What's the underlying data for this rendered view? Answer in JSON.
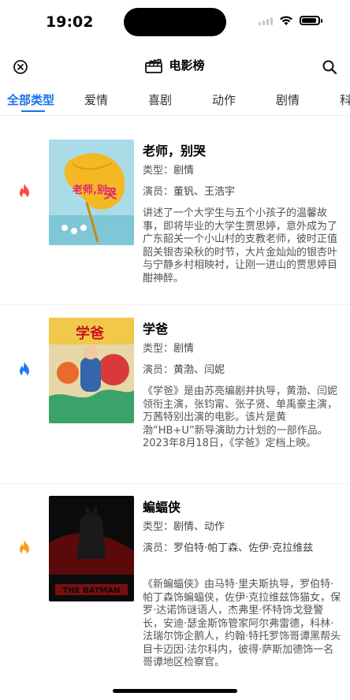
{
  "status": {
    "time": "19:02"
  },
  "nav": {
    "title": "电影榜",
    "close_icon": "close-circle-icon",
    "search_icon": "search-icon",
    "title_icon": "clapperboard-icon"
  },
  "tabs": [
    "全部类型",
    "爱情",
    "喜剧",
    "动作",
    "剧情",
    "科"
  ],
  "active_tab": 0,
  "labels": {
    "genre": "类型：",
    "cast": "演员："
  },
  "movies": [
    {
      "title": "老师，别哭",
      "genre": "剧情",
      "cast": "董钒、王浩宇",
      "description": "讲述了一个大学生与五个小孩子的温馨故事，即将毕业的大学生贾思婷，意外成为了广东韶关一个小山村的支教老师，彼时正值韶关银杏染秋的时节，大片金灿灿的银杏叶与宁静乡村相映衬，让刚一进山的贾思婷目酣神醉。",
      "flame_color": "#ff4a3d",
      "poster_text": "老师，别哭"
    },
    {
      "title": "学爸",
      "genre": "剧情",
      "cast": "黄渤、闫妮",
      "description": "《学爸》是由苏亮编剧并执导，黄渤、闫妮领衔主演，张钧甯、张子贤、单禹豪主演，万茜特别出演的电影。该片是黄渤“HB+U”新导演助力计划的一部作品。2023年8月18日，《学爸》定档上映。",
      "flame_color": "#1a7df0",
      "poster_text": "学爸"
    },
    {
      "title": "蝙蝠侠",
      "genre": "剧情、动作",
      "cast": "罗伯特·帕丁森、佐伊·克拉维兹",
      "description": "《新蝙蝠侠》由马特·里夫斯执导，罗伯特·帕丁森饰蝙蝠侠，佐伊·克拉维兹饰猫女，保罗·达诺饰谜语人，杰弗里·怀特饰戈登警长，安迪·瑟金斯饰管家阿尔弗雷德，科林·法瑞尔饰企鹅人，约翰·特托罗饰哥谭黑帮头目卡迈因·法尔科内，彼得·萨斯加德饰一名哥谭地区检察官。",
      "flame_color": "#ff9a1a",
      "poster_text": "THE BATMAN"
    }
  ]
}
